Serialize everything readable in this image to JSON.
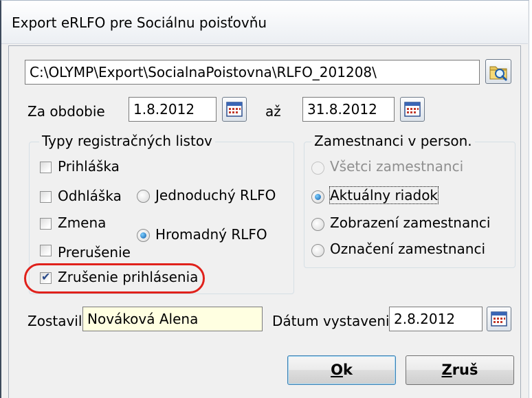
{
  "window": {
    "title": "Export eRLFO pre Sociálnu poisťovňu"
  },
  "path": {
    "value": "C:\\OLYMP\\Export\\SocialnaPoistovna\\RLFO_201208\\"
  },
  "period": {
    "label": "Za obdobie",
    "from": "1.8.2012",
    "to_label": "až",
    "to": "31.8.2012"
  },
  "registration_types": {
    "title": "Typy registračných listov",
    "items": [
      {
        "label": "Prihláška",
        "checked": false
      },
      {
        "label": "Odhláška",
        "checked": false
      },
      {
        "label": "Zmena",
        "checked": false
      },
      {
        "label": "Prerušenie",
        "checked": false
      },
      {
        "label": "Zrušenie prihlásenia",
        "checked": true
      }
    ],
    "mode_options": [
      {
        "label": "Jednoduchý RLFO",
        "selected": false
      },
      {
        "label": "Hromadný RLFO",
        "selected": true
      }
    ]
  },
  "employees": {
    "title": "Zamestnanci v person.",
    "options": [
      {
        "label": "Všetci zamestnanci",
        "selected": false,
        "disabled": true
      },
      {
        "label": "Aktuálny riadok",
        "selected": true,
        "disabled": false
      },
      {
        "label": "Zobrazení zamestnanci",
        "selected": false,
        "disabled": false
      },
      {
        "label": "Označení zamestnanci",
        "selected": false,
        "disabled": false
      }
    ]
  },
  "author": {
    "label": "Zostavil",
    "value": "Nováková Alena"
  },
  "issue_date": {
    "label": "Dátum vystavenia",
    "value": "2.8.2012"
  },
  "buttons": {
    "ok_underlined": "O",
    "ok_rest": "k",
    "cancel_underlined": "Z",
    "cancel_rest": "ruš"
  },
  "colors": {
    "highlight_ring": "#e0211b",
    "author_field_bg": "#ffffe1"
  }
}
